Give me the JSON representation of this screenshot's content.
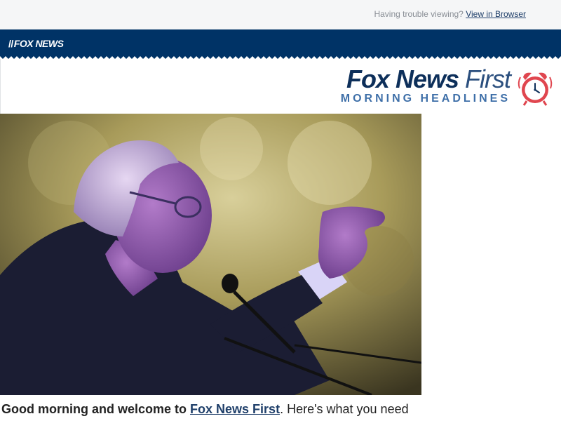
{
  "topbar": {
    "trouble_text": "Having trouble viewing?",
    "view_link": "View in Browser"
  },
  "navbar": {
    "logo_text": "FOX NEWS",
    "bg_color": "#003366"
  },
  "header": {
    "brand_bold": "Fox News",
    "brand_light": "First",
    "subtitle": "MORNING HEADLINES",
    "clock_icon": "alarm-clock-icon",
    "clock_color": "#e0464f"
  },
  "lead": {
    "greeting": "Good morning and welcome to",
    "link": "Fox News First",
    "rest": ". Here's what you need"
  }
}
